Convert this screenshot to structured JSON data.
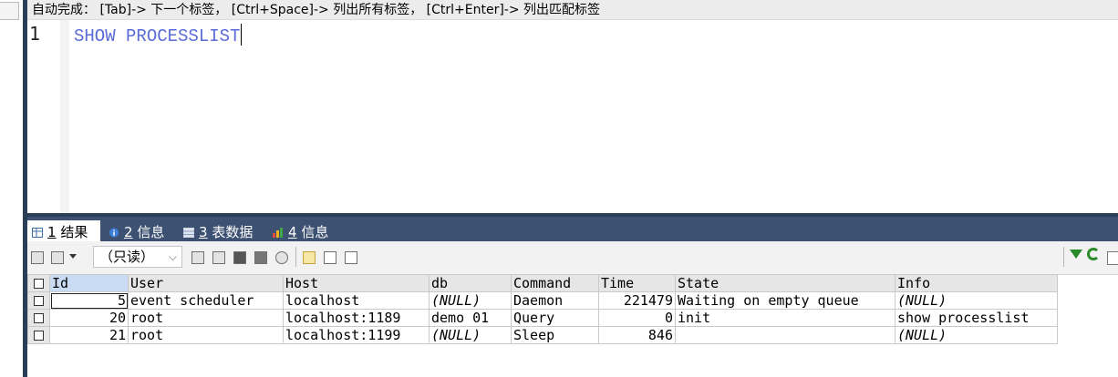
{
  "editor": {
    "hint": "自动完成： [Tab]-> 下一个标签， [Ctrl+Space]-> 列出所有标签， [Ctrl+Enter]-> 列出匹配标签",
    "line_number": "1",
    "code": "SHOW PROCESSLIST"
  },
  "results": {
    "tabs": [
      {
        "num": "1",
        "label": "结果"
      },
      {
        "num": "2",
        "label": "信息"
      },
      {
        "num": "3",
        "label": "表数据"
      },
      {
        "num": "4",
        "label": "信息"
      }
    ],
    "toolbar": {
      "readonly_label": "（只读）",
      "readonly_chevron": "⌵"
    },
    "columns": [
      "Id",
      "User",
      "Host",
      "db",
      "Command",
      "Time",
      "State",
      "Info"
    ],
    "rows": [
      [
        "5",
        "event scheduler",
        "localhost",
        "(NULL)",
        "Daemon",
        "221479",
        "Waiting on empty queue",
        "(NULL)"
      ],
      [
        "20",
        "root",
        "localhost:1189",
        "demo 01",
        "Query",
        "0",
        "init",
        "show processlist"
      ],
      [
        "21",
        "root",
        "localhost:1199",
        "(NULL)",
        "Sleep",
        "846",
        "",
        "(NULL)"
      ]
    ]
  }
}
